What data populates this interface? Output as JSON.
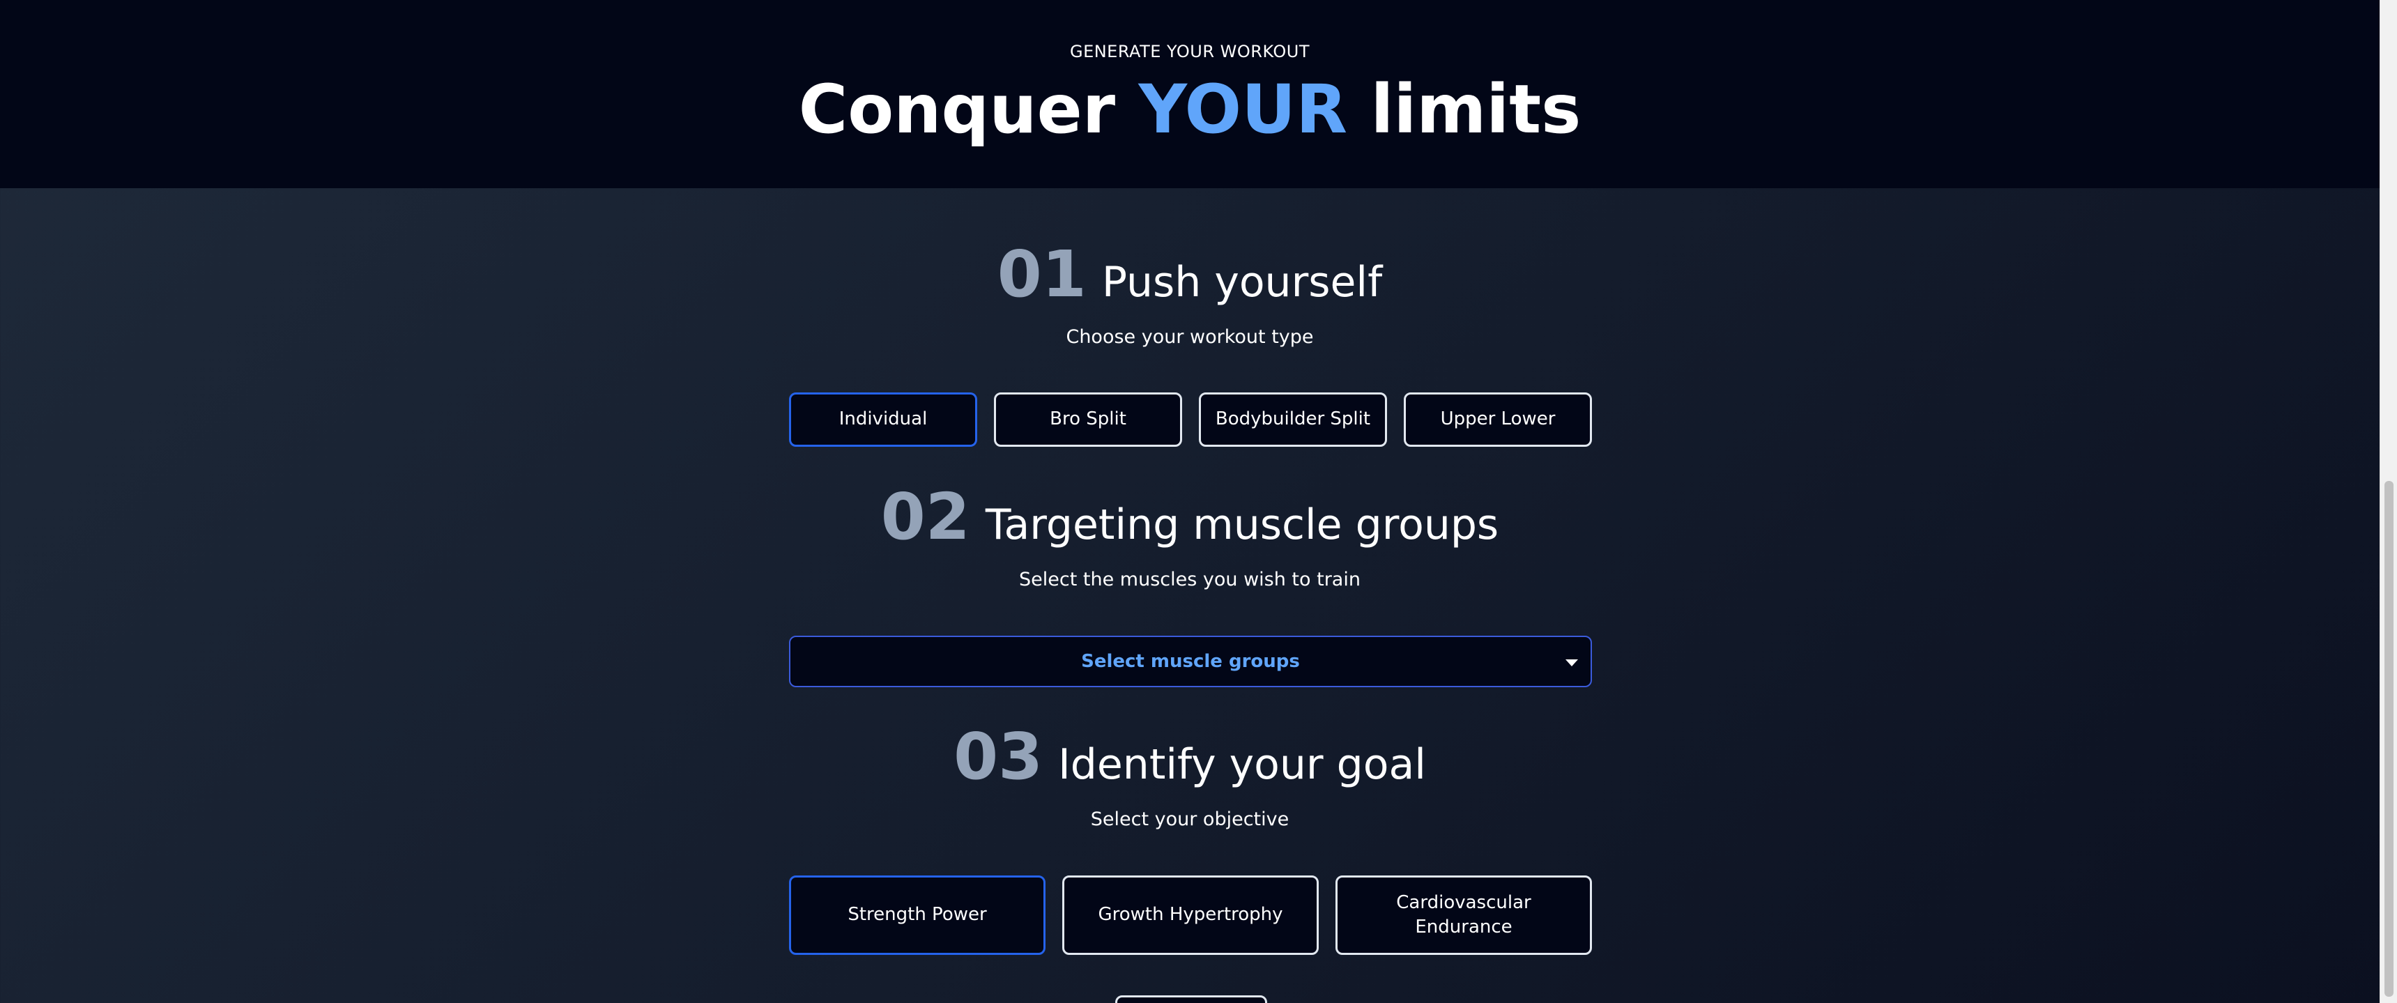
{
  "hero": {
    "eyebrow": "GENERATE YOUR WORKOUT",
    "title_part1": "Conquer ",
    "title_accent": "YOUR",
    "title_part2": " limits"
  },
  "sections": [
    {
      "number": "01",
      "title": "Push yourself",
      "subtitle": "Choose your workout type",
      "options": [
        "Individual",
        "Bro Split",
        "Bodybuilder Split",
        "Upper Lower"
      ],
      "selected": "Individual"
    },
    {
      "number": "02",
      "title": "Targeting muscle groups",
      "subtitle": "Select the muscles you wish to train",
      "select_label": "Select muscle groups",
      "select_icon": "caret-down-icon"
    },
    {
      "number": "03",
      "title": "Identify your goal",
      "subtitle": "Select your objective",
      "options": [
        "Strength Power",
        "Growth Hypertrophy",
        "Cardiovascular Endurance"
      ],
      "selected": "Strength Power"
    }
  ],
  "colors": {
    "accent": "#60a5fa",
    "selected_border": "#2563eb",
    "number": "#94a3b8",
    "hero_bg": "#020617"
  }
}
